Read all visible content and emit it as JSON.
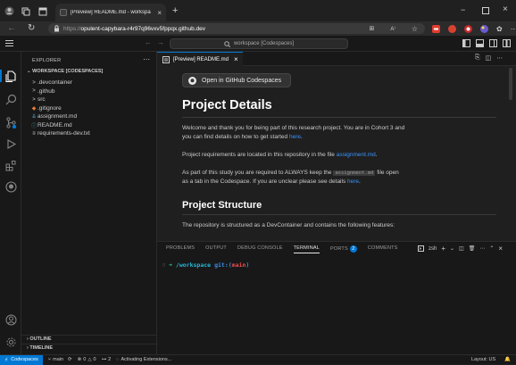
{
  "browser": {
    "tab_title": "[Preview] README.md - workspa",
    "url_proto": "https://",
    "url_host": "opulent-capybara-r4r97q96vxv5fppqx.github.dev"
  },
  "vscode": {
    "command_center": "workspace [Codespaces]",
    "explorer": {
      "title": "EXPLORER",
      "workspace": "WORKSPACE [CODESPACES]",
      "items": [
        {
          "label": ".devcontainer",
          "glyph": ">"
        },
        {
          "label": ".github",
          "glyph": ">"
        },
        {
          "label": "src",
          "glyph": ">"
        },
        {
          "label": ".gitignore",
          "glyph": "◆"
        },
        {
          "label": "assignment.md",
          "glyph": "⇊"
        },
        {
          "label": "README.md",
          "glyph": "ⓘ"
        },
        {
          "label": "requirements-dev.txt",
          "glyph": "≡"
        }
      ],
      "outline": "OUTLINE",
      "timeline": "TIMELINE"
    },
    "editor_tab": "[Preview] README.md",
    "preview": {
      "codespaces_button": "Open in GitHub Codespaces",
      "h1": "Project Details",
      "p1_text": "Welcome and thank you for being part of this research project. You are in Cohort 3 and you can find details on how to get started ",
      "p1_link": "here",
      "p1_end": ".",
      "p2_text": "Project requirements are located in this repository in the file ",
      "p2_link": "assignment.md",
      "p2_end": ".",
      "p3_text": "As part of this study you are required to ALWAYS keep the ",
      "p3_code": "assignment.md",
      "p3_text2": " file open as a tab in the Codespace. If you are unclear please see details ",
      "p3_link": "here",
      "p3_end": ".",
      "h2": "Project Structure",
      "p4_text": "The repository is structured as a DevContainer and contains the following features:"
    },
    "panel": {
      "tabs": [
        "PROBLEMS",
        "OUTPUT",
        "DEBUG CONSOLE",
        "TERMINAL",
        "PORTS",
        "COMMENTS"
      ],
      "ports_count": "2",
      "shell": "zsh",
      "terminal_path": "/workspace",
      "terminal_git": "git:(",
      "terminal_branch": "main",
      "terminal_close": ")"
    },
    "status": {
      "remote": "Codespaces",
      "branch": "main",
      "errors": "0",
      "warnings": "0",
      "ports": "2",
      "activity": "Activating Extensions...",
      "layout": "Layout: US"
    }
  },
  "colors": {
    "accent": "#0078d4",
    "link": "#3794ff"
  }
}
